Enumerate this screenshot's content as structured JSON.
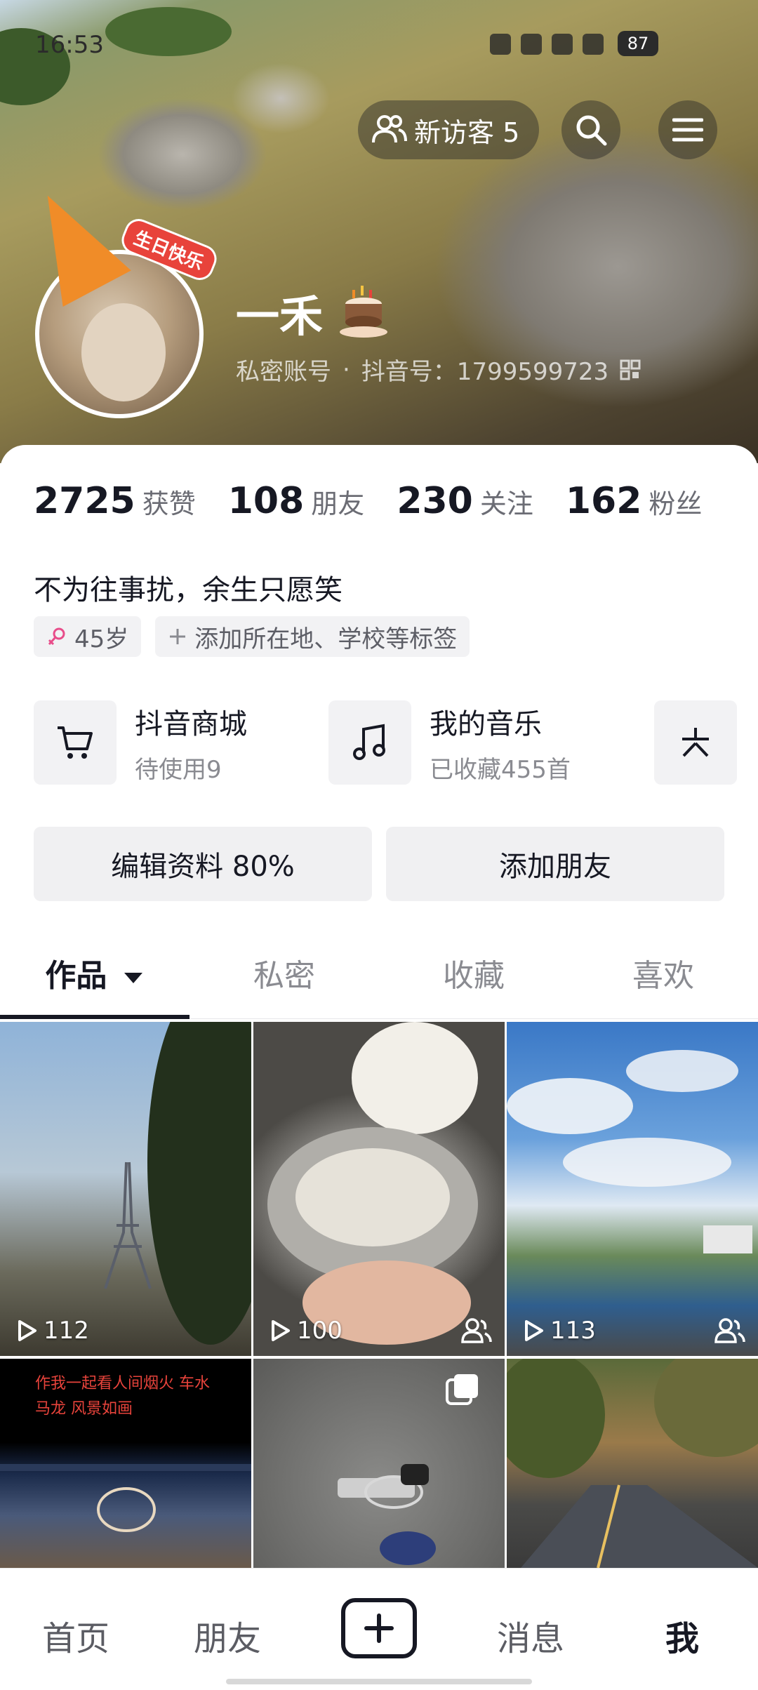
{
  "status_bar": {
    "time": "16:53",
    "battery": "87"
  },
  "header": {
    "visitor_label": "新访客 5",
    "birthday_badge": "生日快乐",
    "name": "一禾",
    "private_label": "私密账号",
    "separator": "·",
    "douyin_id": "抖音号：1799599723"
  },
  "stats": [
    {
      "value": "2725",
      "label": "获赞"
    },
    {
      "value": "108",
      "label": "朋友"
    },
    {
      "value": "230",
      "label": "关注"
    },
    {
      "value": "162",
      "label": "粉丝"
    }
  ],
  "bio": "不为往事扰，余生只愿笑",
  "tags": [
    {
      "icon": "female-icon",
      "label": "45岁"
    },
    {
      "icon": "plus-icon",
      "label": "添加所在地、学校等标签"
    }
  ],
  "services": [
    {
      "icon": "cart-icon",
      "title": "抖音商城",
      "subtitle": "待使用9"
    },
    {
      "icon": "music-note-icon",
      "title": "我的音乐",
      "subtitle": "已收藏455首"
    },
    {
      "icon": "asterisk-icon",
      "title": "",
      "subtitle": ""
    }
  ],
  "actions": {
    "edit_profile": "编辑资料 80%",
    "add_friend": "添加朋友"
  },
  "tabs": [
    {
      "label": "作品"
    },
    {
      "label": "私密"
    },
    {
      "label": "收藏"
    },
    {
      "label": "喜欢"
    }
  ],
  "grid": [
    {
      "plays": "112",
      "friends_visible": false
    },
    {
      "plays": "100",
      "friends_visible": true
    },
    {
      "plays": "113",
      "friends_visible": true
    },
    {
      "overlay_text": "作我一起看人间烟火 车水马龙 风景如画"
    },
    {
      "multi_image": true
    },
    {}
  ],
  "bottom_nav": [
    {
      "label": "首页"
    },
    {
      "label": "朋友"
    },
    {
      "label": "消息"
    },
    {
      "label": "我"
    }
  ],
  "colors": {
    "primary_text": "#161823",
    "secondary_text": "#8a8b91",
    "button_bg": "#f0f0f2"
  }
}
